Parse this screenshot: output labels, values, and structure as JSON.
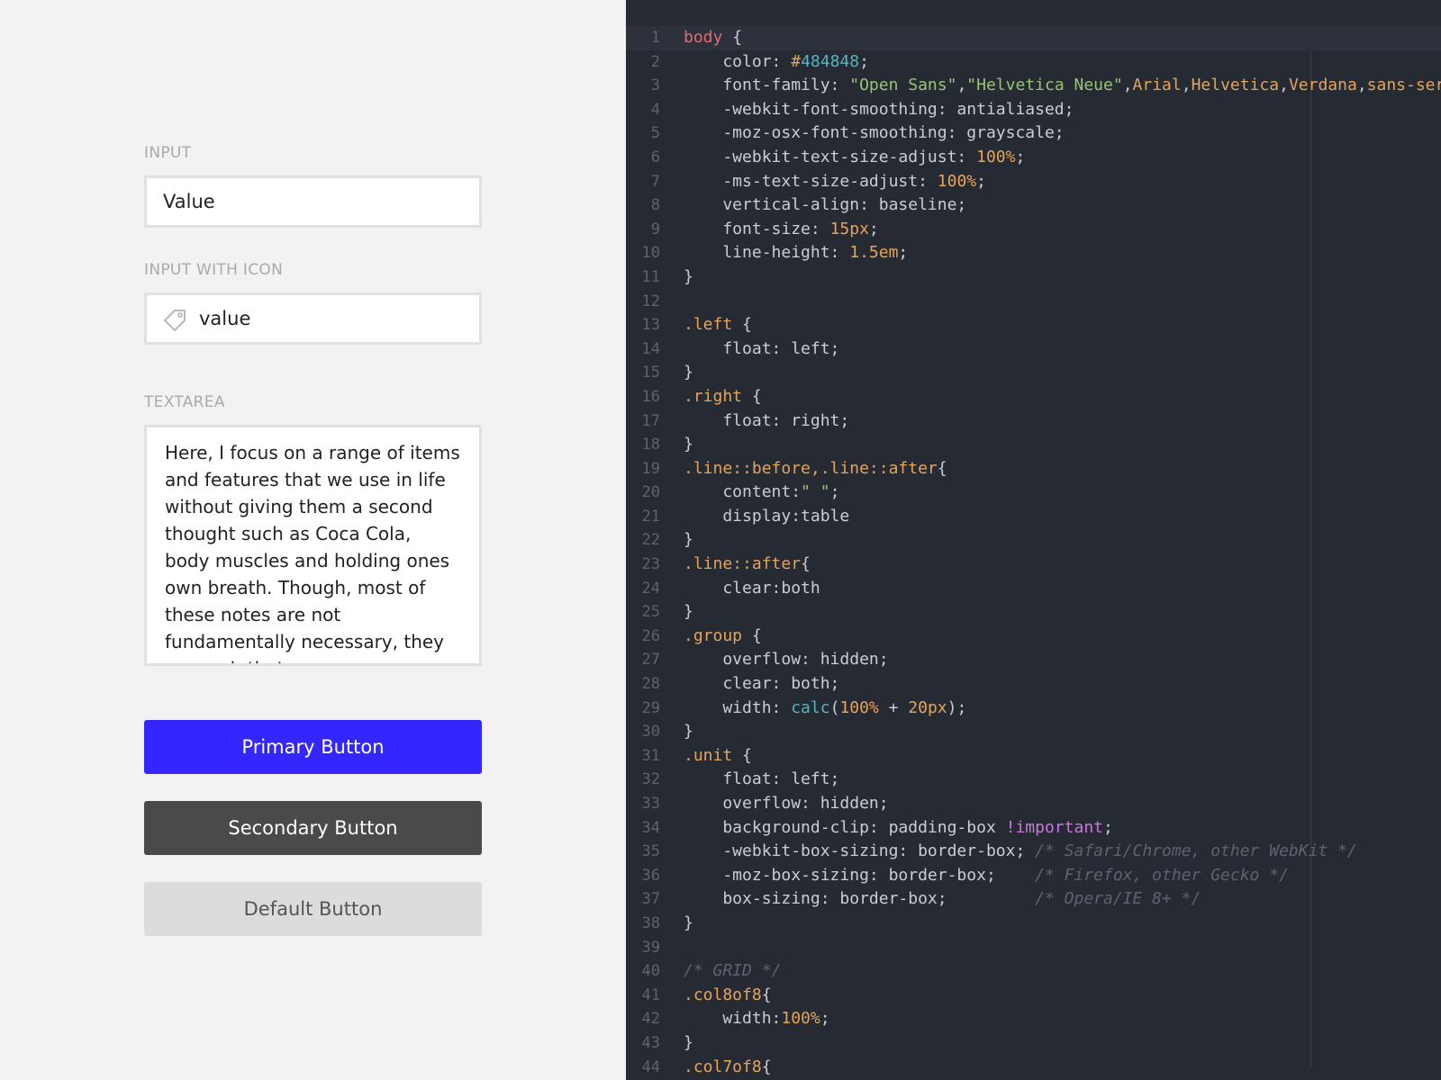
{
  "form": {
    "input_label": "INPUT",
    "input_value": "Value",
    "icon_input_label": "INPUT WITH ICON",
    "icon_input_value": "value",
    "icon_input_icon": "tag-icon",
    "textarea_label": "TEXTAREA",
    "textarea_value": "Here, I focus on a range of items and features that we use in life without giving them a second thought such as Coca Cola, body muscles and holding ones own breath. Though, most of these notes are not fundamentally necessary, they are such that you",
    "primary_button": "Primary Button",
    "secondary_button": "Secondary Button",
    "default_button": "Default Button"
  },
  "colors": {
    "primary": "#3326ff",
    "secondary": "#4a4a4a",
    "default": "#dcdcdc",
    "editor_background": "#262a33"
  },
  "editor": {
    "line_numbers": [
      "1",
      "2",
      "3",
      "4",
      "5",
      "6",
      "7",
      "8",
      "9",
      "10",
      "11",
      "12",
      "13",
      "14",
      "15",
      "16",
      "17",
      "18",
      "19",
      "20",
      "21",
      "22",
      "23",
      "24",
      "25",
      "26",
      "27",
      "28",
      "29",
      "30",
      "31",
      "32",
      "33",
      "34",
      "35",
      "36",
      "37",
      "38",
      "39",
      "40",
      "41",
      "42",
      "43",
      "44"
    ],
    "lines": [
      [
        [
          "tag",
          "body"
        ],
        [
          "txt",
          " {"
        ]
      ],
      [
        [
          "txt",
          "    color: "
        ],
        [
          "num",
          "#"
        ],
        [
          "hex",
          "484848"
        ],
        [
          "txt",
          ";"
        ]
      ],
      [
        [
          "txt",
          "    font-family: "
        ],
        [
          "str",
          "\"Open Sans\""
        ],
        [
          "txt",
          ","
        ],
        [
          "str",
          "\"Helvetica Neue\""
        ],
        [
          "txt",
          ","
        ],
        [
          "val",
          "Arial"
        ],
        [
          "txt",
          ","
        ],
        [
          "val",
          "Helvetica"
        ],
        [
          "txt",
          ","
        ],
        [
          "val",
          "Verdana"
        ],
        [
          "txt",
          ","
        ],
        [
          "val",
          "sans-seri"
        ]
      ],
      [
        [
          "txt",
          "    -webkit-font-smoothing: antialiased;"
        ]
      ],
      [
        [
          "txt",
          "    -moz-osx-font-smoothing: grayscale;"
        ]
      ],
      [
        [
          "txt",
          "    -webkit-text-size-adjust: "
        ],
        [
          "num",
          "100%"
        ],
        [
          "txt",
          ";"
        ]
      ],
      [
        [
          "txt",
          "    -ms-text-size-adjust: "
        ],
        [
          "num",
          "100%"
        ],
        [
          "txt",
          ";"
        ]
      ],
      [
        [
          "txt",
          "    vertical-align: baseline;"
        ]
      ],
      [
        [
          "txt",
          "    font-size: "
        ],
        [
          "num",
          "15px"
        ],
        [
          "txt",
          ";"
        ]
      ],
      [
        [
          "txt",
          "    line-height: "
        ],
        [
          "num",
          "1.5em"
        ],
        [
          "txt",
          ";"
        ]
      ],
      [
        [
          "txt",
          "}"
        ]
      ],
      [
        [
          "txt",
          ""
        ]
      ],
      [
        [
          "sel",
          ".left"
        ],
        [
          "txt",
          " {"
        ]
      ],
      [
        [
          "txt",
          "    float: left;"
        ]
      ],
      [
        [
          "txt",
          "}"
        ]
      ],
      [
        [
          "sel",
          ".right"
        ],
        [
          "txt",
          " {"
        ]
      ],
      [
        [
          "txt",
          "    float: right;"
        ]
      ],
      [
        [
          "txt",
          "}"
        ]
      ],
      [
        [
          "sel",
          ".line::before,.line::after"
        ],
        [
          "txt",
          "{"
        ]
      ],
      [
        [
          "txt",
          "    content:"
        ],
        [
          "str",
          "\" \""
        ],
        [
          "txt",
          ";"
        ]
      ],
      [
        [
          "txt",
          "    display:table"
        ]
      ],
      [
        [
          "txt",
          "}"
        ]
      ],
      [
        [
          "sel",
          ".line::after"
        ],
        [
          "txt",
          "{"
        ]
      ],
      [
        [
          "txt",
          "    clear:both"
        ]
      ],
      [
        [
          "txt",
          "}"
        ]
      ],
      [
        [
          "sel",
          ".group"
        ],
        [
          "txt",
          " {"
        ]
      ],
      [
        [
          "txt",
          "    overflow: hidden;"
        ]
      ],
      [
        [
          "txt",
          "    clear: both;"
        ]
      ],
      [
        [
          "txt",
          "    width: "
        ],
        [
          "fn",
          "calc"
        ],
        [
          "txt",
          "("
        ],
        [
          "num",
          "100%"
        ],
        [
          "txt",
          " + "
        ],
        [
          "num",
          "20px"
        ],
        [
          "txt",
          ");"
        ]
      ],
      [
        [
          "txt",
          "}"
        ]
      ],
      [
        [
          "sel",
          ".unit"
        ],
        [
          "txt",
          " {"
        ]
      ],
      [
        [
          "txt",
          "    float: left;"
        ]
      ],
      [
        [
          "txt",
          "    overflow: hidden;"
        ]
      ],
      [
        [
          "txt",
          "    background-clip: padding-box "
        ],
        [
          "imp",
          "!important"
        ],
        [
          "txt",
          ";"
        ]
      ],
      [
        [
          "txt",
          "    -webkit-box-sizing: border-box; "
        ],
        [
          "com",
          "/* Safari/Chrome, other WebKit */"
        ]
      ],
      [
        [
          "txt",
          "    -moz-box-sizing: border-box;    "
        ],
        [
          "com",
          "/* Firefox, other Gecko */"
        ]
      ],
      [
        [
          "txt",
          "    box-sizing: border-box;         "
        ],
        [
          "com",
          "/* Opera/IE 8+ */"
        ]
      ],
      [
        [
          "txt",
          "}"
        ]
      ],
      [
        [
          "txt",
          ""
        ]
      ],
      [
        [
          "com",
          "/* GRID */"
        ]
      ],
      [
        [
          "sel",
          ".col8of8"
        ],
        [
          "txt",
          "{"
        ]
      ],
      [
        [
          "txt",
          "    width:"
        ],
        [
          "num",
          "100%"
        ],
        [
          "txt",
          ";"
        ]
      ],
      [
        [
          "txt",
          "}"
        ]
      ],
      [
        [
          "sel",
          ".col7of8"
        ],
        [
          "txt",
          "{"
        ]
      ]
    ]
  }
}
